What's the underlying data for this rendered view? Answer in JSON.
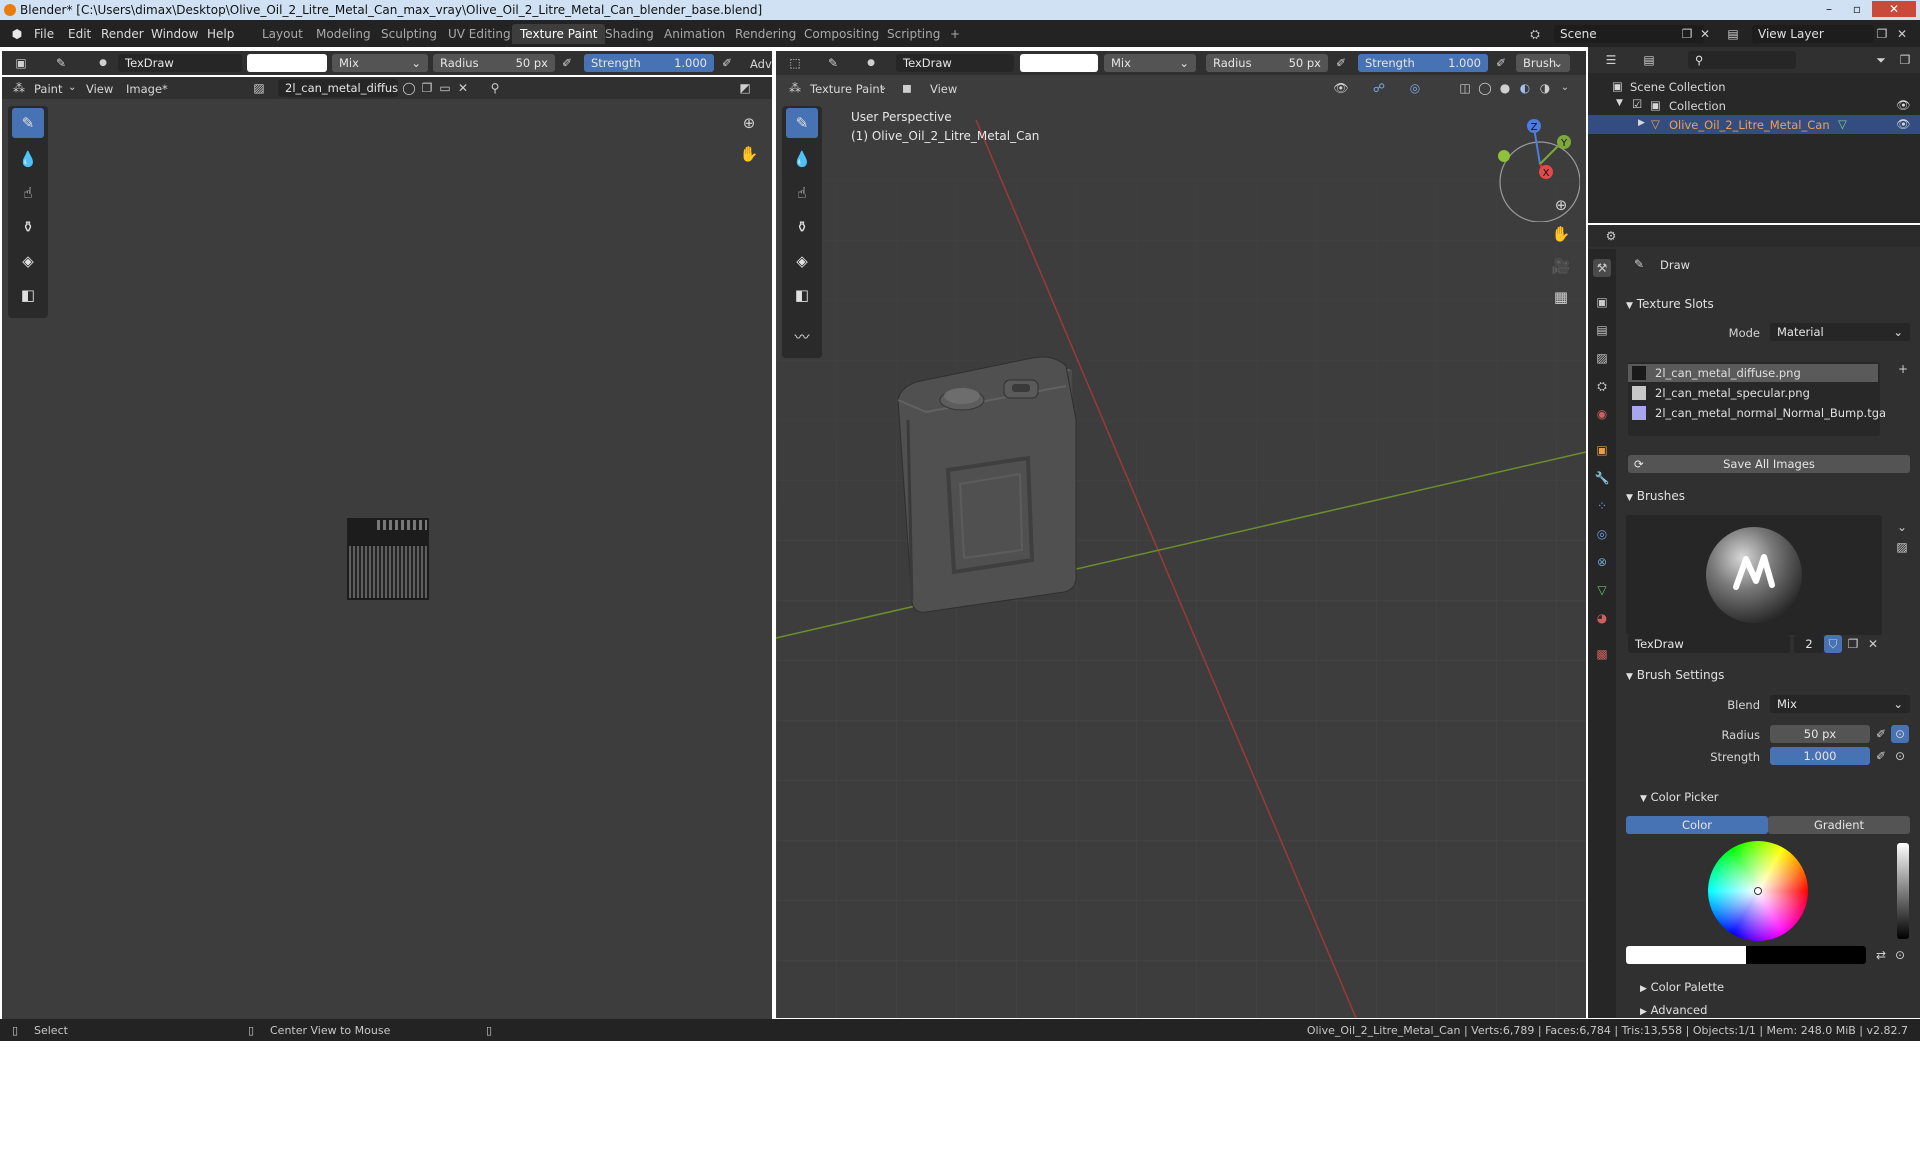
{
  "window": {
    "title": "Blender* [C:\\Users\\dimax\\Desktop\\Olive_Oil_2_Litre_Metal_Can_max_vray\\Olive_Oil_2_Litre_Metal_Can_blender_base.blend]",
    "min": "–",
    "max": "▫",
    "close": "✕"
  },
  "menu": [
    "File",
    "Edit",
    "Render",
    "Window",
    "Help"
  ],
  "workspaces": [
    "Layout",
    "Modeling",
    "Sculpting",
    "UV Editing",
    "Texture Paint",
    "Shading",
    "Animation",
    "Rendering",
    "Compositing",
    "Scripting"
  ],
  "workspace_add": "+",
  "scene": "Scene",
  "view_layer": "View Layer",
  "image_editor": {
    "brush": "TexDraw",
    "blend": "Mix",
    "radius_label": "Radius",
    "radius_value": "50 px",
    "strength_label": "Strength",
    "strength_value": "1.000",
    "adv": "Adv",
    "mode": "Paint",
    "view": "View",
    "image": "Image*",
    "image_name": "2l_can_metal_diffus.."
  },
  "viewport": {
    "brush": "TexDraw",
    "blend": "Mix",
    "radius_label": "Radius",
    "radius_value": "50 px",
    "strength_label": "Strength",
    "strength_value": "1.000",
    "brush_menu": "Brush",
    "mode": "Texture Paint",
    "view": "View",
    "perspective": "User Perspective",
    "object": "(1) Olive_Oil_2_Litre_Metal_Can",
    "gizmo_z": "Z",
    "gizmo_y": "Y",
    "gizmo_x": "X"
  },
  "outliner": {
    "root": "Scene Collection",
    "collection": "Collection",
    "object": "Olive_Oil_2_Litre_Metal_Can"
  },
  "properties": {
    "tool": "Draw",
    "texture_slots": {
      "title": "Texture Slots",
      "mode_label": "Mode",
      "mode_value": "Material",
      "slots": [
        {
          "name": "2l_can_metal_diffuse.png",
          "color": "#1a1a1a"
        },
        {
          "name": "2l_can_metal_specular.png",
          "color": "#c8c8c8"
        },
        {
          "name": "2l_can_metal_normal_Normal_Bump.tga",
          "color": "#a9a6f0"
        }
      ],
      "save_all": "Save All Images"
    },
    "brushes": {
      "title": "Brushes",
      "name": "TexDraw",
      "users": "2"
    },
    "brush_settings": {
      "title": "Brush Settings",
      "blend_label": "Blend",
      "blend_value": "Mix",
      "radius_label": "Radius",
      "radius_value": "50 px",
      "strength_label": "Strength",
      "strength_value": "1.000"
    },
    "color_picker": {
      "title": "Color Picker",
      "tab_color": "Color",
      "tab_gradient": "Gradient"
    },
    "color_palette": "Color Palette",
    "advanced": "Advanced"
  },
  "status": {
    "select": "Select",
    "center": "Center View to Mouse",
    "stats": "Olive_Oil_2_Litre_Metal_Can | Verts:6,789 | Faces:6,784 | Tris:13,558 | Objects:1/1 | Mem: 248.0 MiB | v2.82.7"
  },
  "colors": {
    "accent": "#4772b3",
    "selection": "#334d80",
    "background": "#3d3d3d",
    "header": "#303030"
  }
}
